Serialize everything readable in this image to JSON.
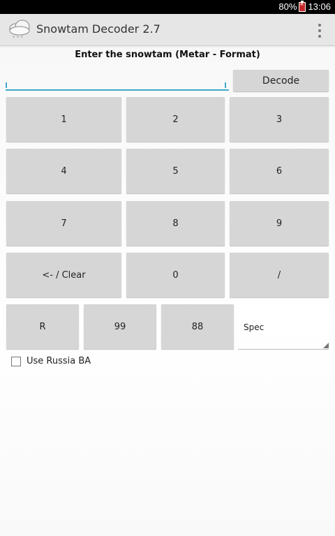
{
  "status_bar": {
    "battery": "80%",
    "time": "13:06"
  },
  "app": {
    "title": "Snowtam Decoder 2.7",
    "icon": "snow-cloud-icon"
  },
  "form": {
    "prompt": "Enter the snowtam (Metar - Format)",
    "input_value": "",
    "decode_label": "Decode"
  },
  "keypad": {
    "k1": "1",
    "k2": "2",
    "k3": "3",
    "k4": "4",
    "k5": "5",
    "k6": "6",
    "k7": "7",
    "k8": "8",
    "k9": "9",
    "clear": "<- / Clear",
    "k0": "0",
    "slash": "/",
    "r": "R",
    "k99": "99",
    "k88": "88"
  },
  "spinner": {
    "selected": "Spec"
  },
  "option": {
    "label": "Use Russia BA",
    "checked": false
  },
  "colors": {
    "accent": "#43a9c9",
    "button": "#d6d6d6",
    "action_bar": "#e6e6e6"
  }
}
